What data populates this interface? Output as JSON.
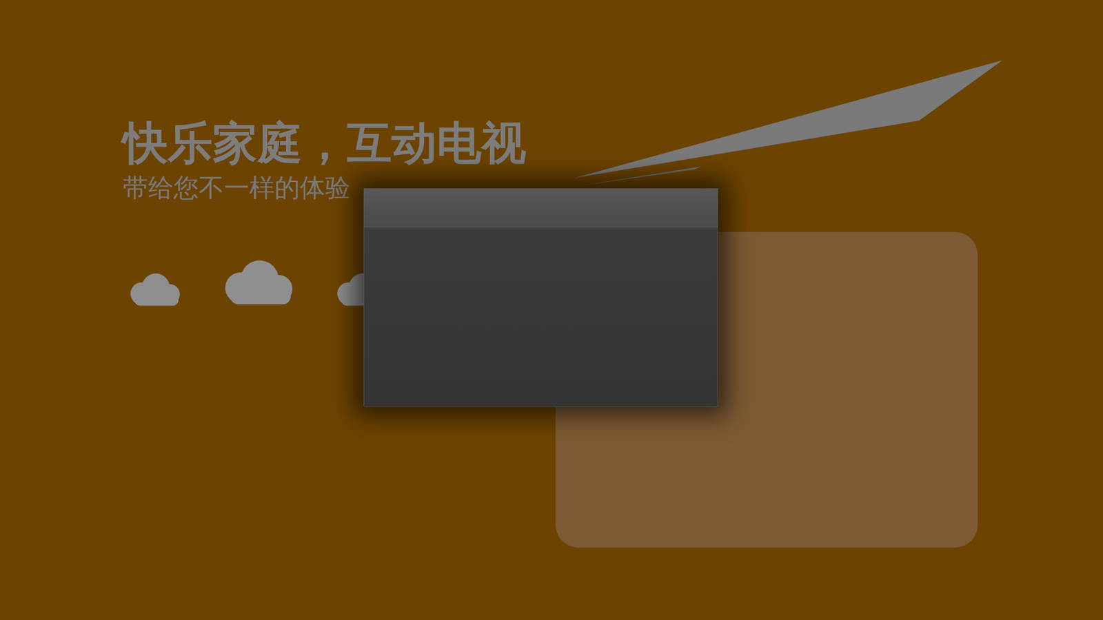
{
  "banner": {
    "title": "快乐家庭，互动电视",
    "subtitle": "带给您不一样的体验"
  }
}
